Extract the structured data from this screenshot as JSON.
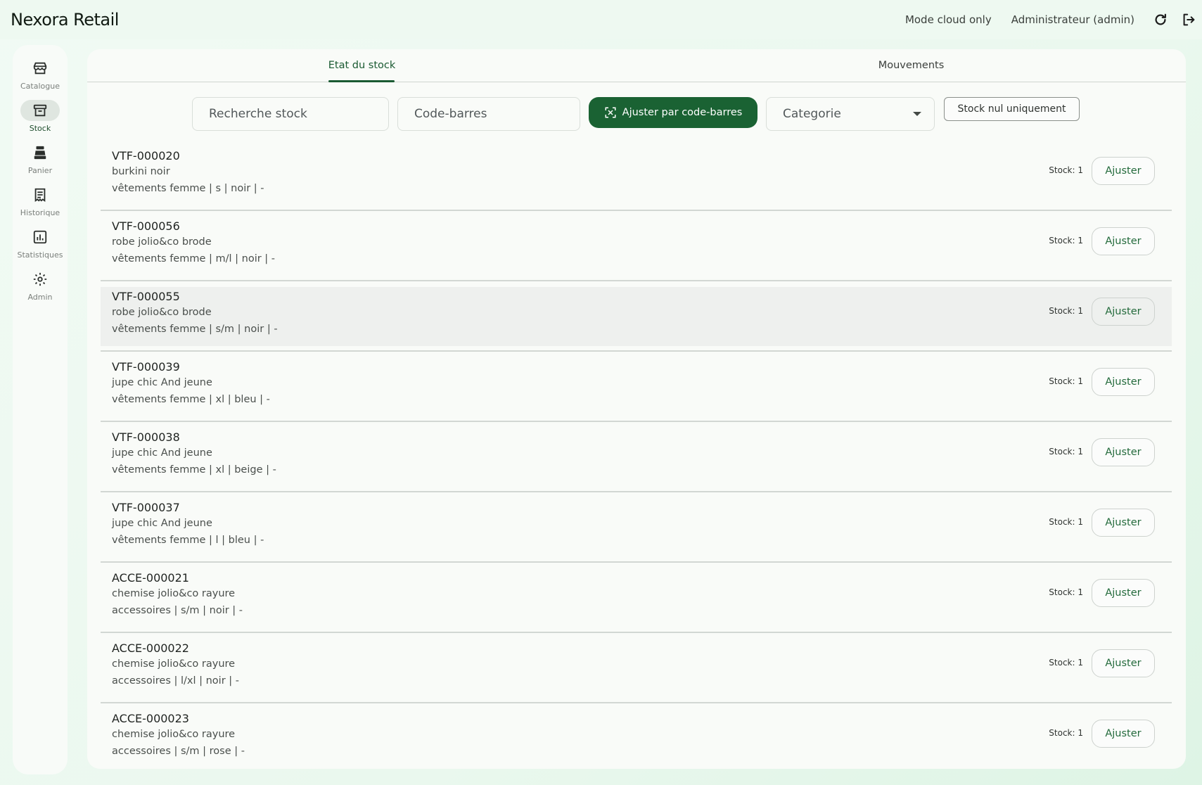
{
  "app": {
    "title": "Nexora Retail"
  },
  "header": {
    "mode": "Mode cloud only",
    "user": "Administrateur (admin)"
  },
  "sidebar": {
    "items": [
      {
        "label": "Catalogue",
        "icon": "store-icon"
      },
      {
        "label": "Stock",
        "icon": "archive-box-icon",
        "active": true
      },
      {
        "label": "Panier",
        "icon": "cash-register-icon"
      },
      {
        "label": "Historique",
        "icon": "receipt-icon"
      },
      {
        "label": "Statistiques",
        "icon": "bar-chart-icon"
      },
      {
        "label": "Admin",
        "icon": "gear-icon"
      }
    ]
  },
  "tabs": [
    {
      "label": "Etat du stock",
      "active": true
    },
    {
      "label": "Mouvements"
    }
  ],
  "filters": {
    "search_placeholder": "Recherche stock",
    "barcode_placeholder": "Code-barres",
    "scan_button": "Ajuster par code-barres",
    "category_placeholder": "Categorie",
    "zero_stock_button": "Stock nul uniquement"
  },
  "colors": {
    "accent": "#1a6233",
    "background": "#eef9f1"
  },
  "stock_label": "Stock: 1",
  "adjust_label": "Ajuster",
  "rows": [
    {
      "sku": "VTF-000020",
      "name": "burkini noir",
      "meta": "vêtements femme | s | noir | -"
    },
    {
      "sku": "VTF-000056",
      "name": "robe jolio&co brode",
      "meta": "vêtements femme | m/l | noir | -"
    },
    {
      "sku": "VTF-000055",
      "name": "robe jolio&co brode",
      "meta": "vêtements femme | s/m | noir | -"
    },
    {
      "sku": "VTF-000039",
      "name": "jupe chic And jeune",
      "meta": "vêtements femme | xl | bleu | -"
    },
    {
      "sku": "VTF-000038",
      "name": "jupe chic And jeune",
      "meta": "vêtements femme | xl | beige | -"
    },
    {
      "sku": "VTF-000037",
      "name": "jupe chic And jeune",
      "meta": "vêtements femme | l | bleu | -"
    },
    {
      "sku": "ACCE-000021",
      "name": "chemise jolio&co rayure",
      "meta": "accessoires | s/m | noir | -"
    },
    {
      "sku": "ACCE-000022",
      "name": "chemise jolio&co rayure",
      "meta": "accessoires | l/xl | noir | -"
    },
    {
      "sku": "ACCE-000023",
      "name": "chemise jolio&co rayure",
      "meta": "accessoires | s/m | rose | -"
    }
  ]
}
